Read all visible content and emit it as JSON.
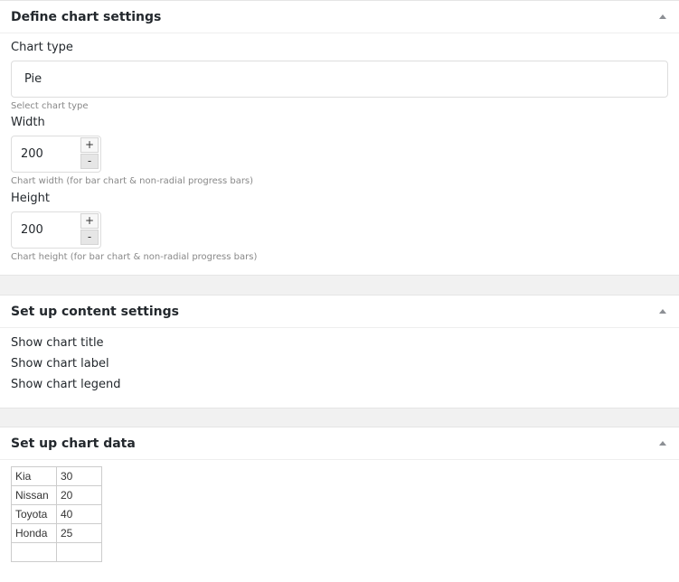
{
  "chart_settings": {
    "title": "Define chart settings",
    "chart_type": {
      "label": "Chart type",
      "value": "Pie",
      "help": "Select chart type"
    },
    "width": {
      "label": "Width",
      "value": "200",
      "plus": "+",
      "minus": "-",
      "help": "Chart width (for bar chart & non-radial progress bars)"
    },
    "height": {
      "label": "Height",
      "value": "200",
      "plus": "+",
      "minus": "-",
      "help": "Chart height (for bar chart & non-radial progress bars)"
    }
  },
  "content_settings": {
    "title": "Set up content settings",
    "options": [
      "Show chart title",
      "Show chart label",
      "Show chart legend"
    ]
  },
  "chart_data_panel": {
    "title": "Set up chart data",
    "rows": [
      [
        "Kia",
        "30"
      ],
      [
        "Nissan",
        "20"
      ],
      [
        "Toyota",
        "40"
      ],
      [
        "Honda",
        "25"
      ],
      [
        "",
        ""
      ]
    ]
  },
  "icons": {
    "collapse": "triangle-up-icon"
  },
  "colors": {
    "background": "#f1f1f1",
    "panel": "#ffffff",
    "text": "#23282d",
    "help_text": "#888888",
    "border": "#dddddd"
  }
}
